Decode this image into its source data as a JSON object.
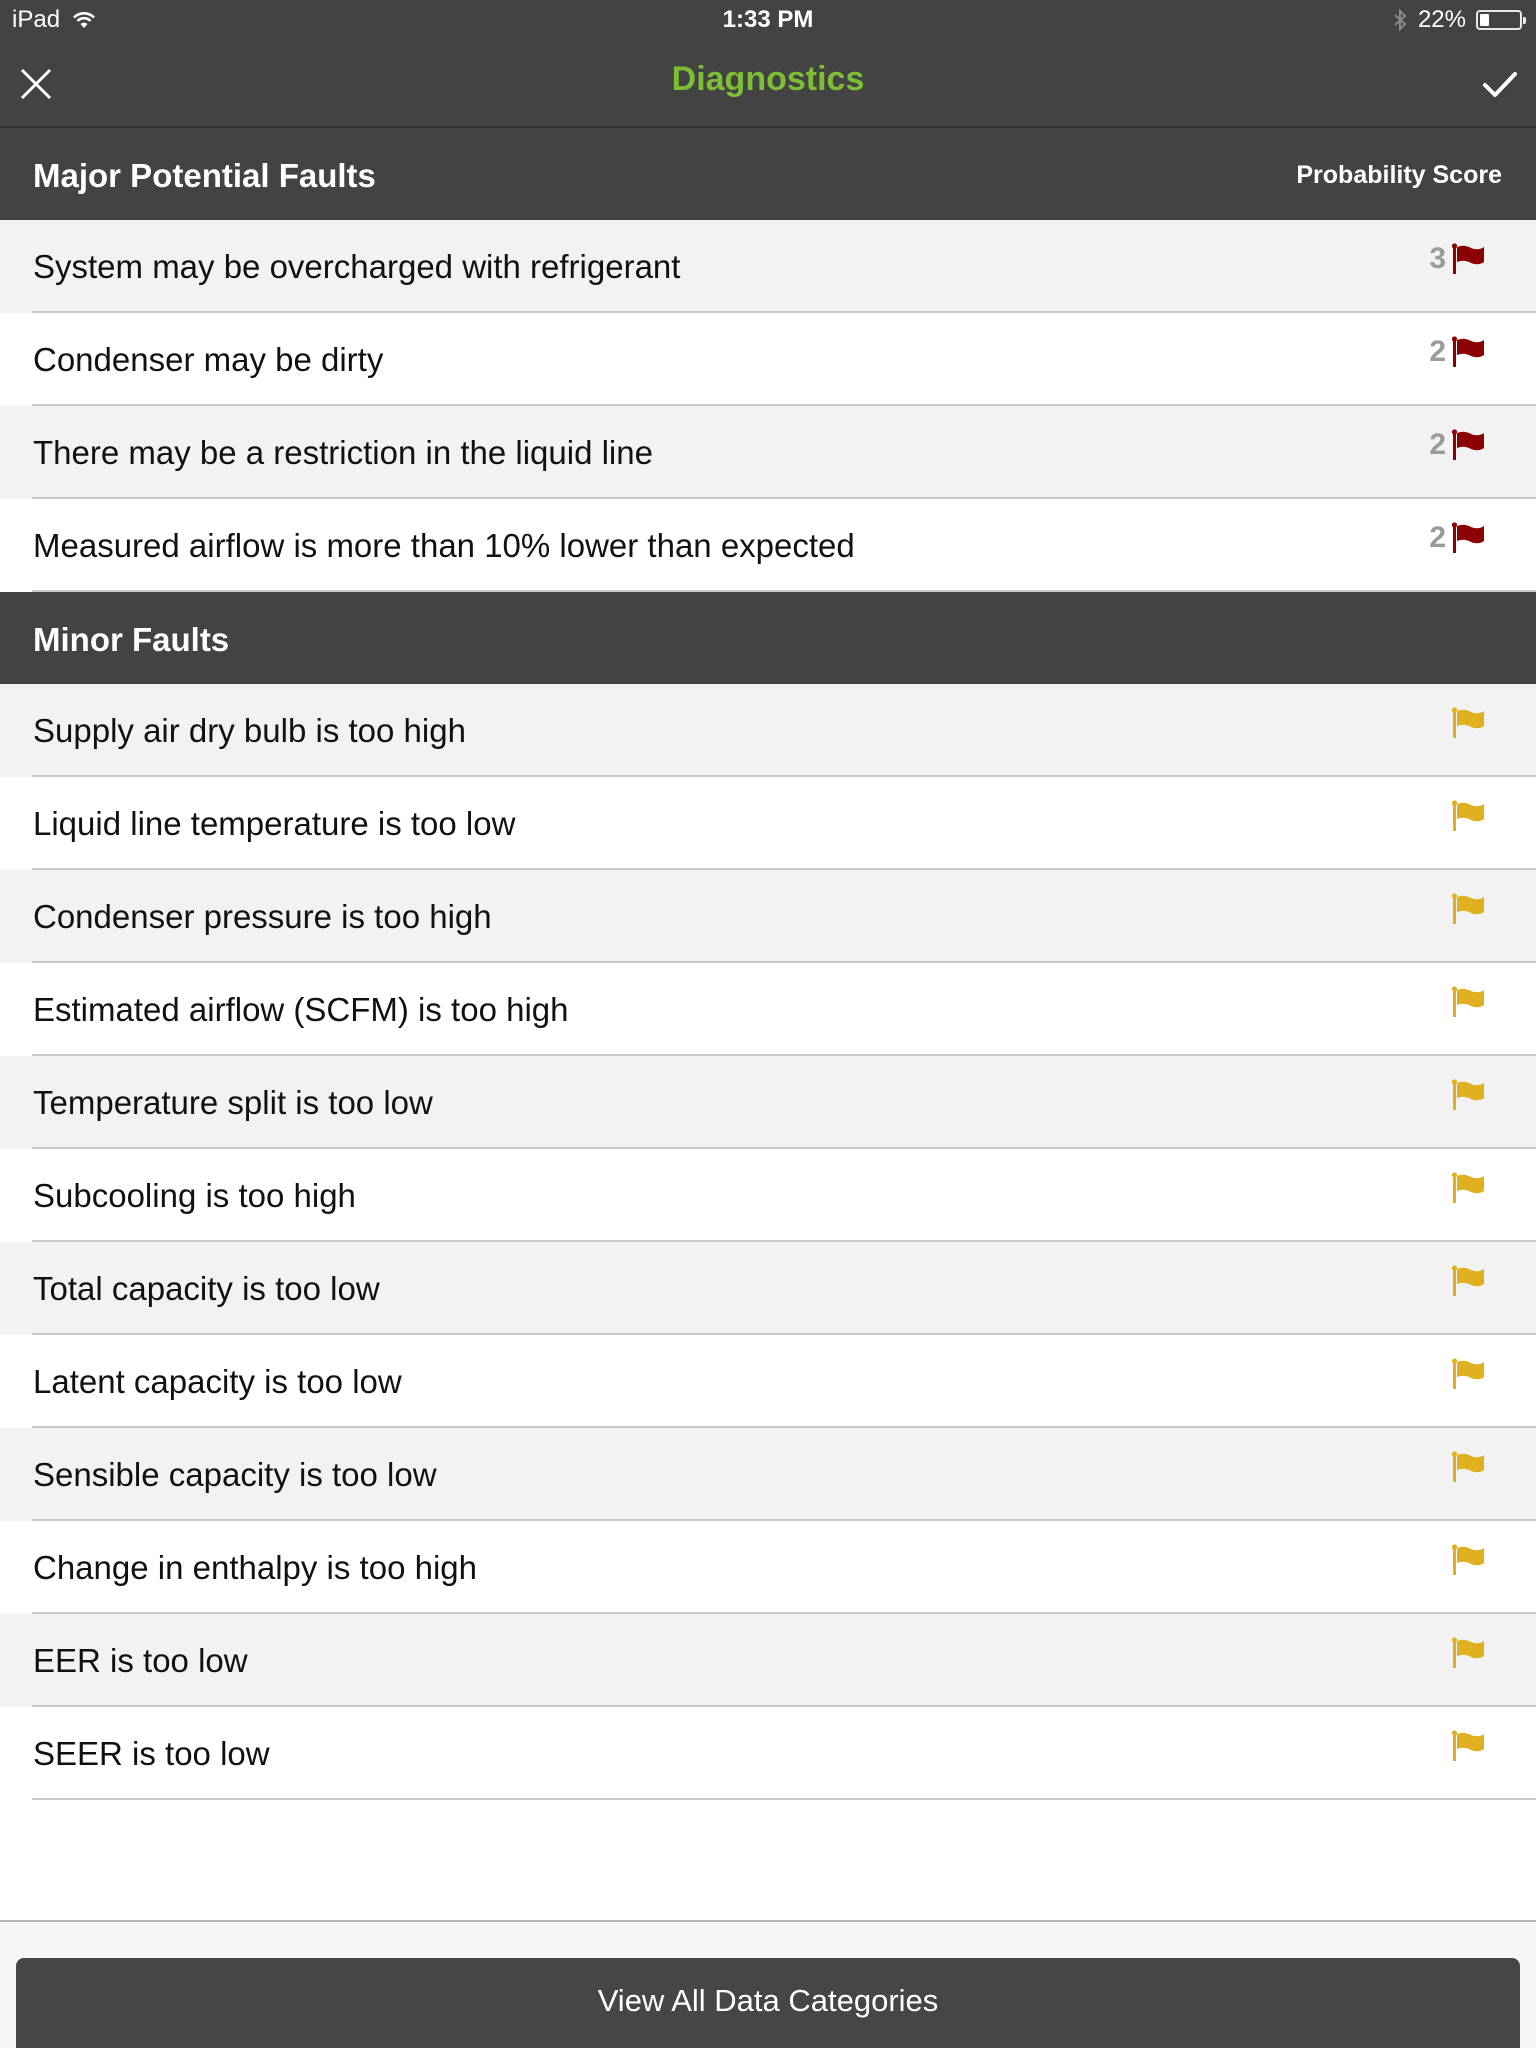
{
  "status_bar": {
    "carrier": "iPad",
    "time": "1:33 PM",
    "battery_percent_label": "22%",
    "battery_level": 0.22,
    "icons": [
      "wifi-icon",
      "bluetooth-icon",
      "battery-icon"
    ]
  },
  "nav": {
    "title": "Diagnostics",
    "close_icon": "close-icon",
    "done_icon": "checkmark-icon"
  },
  "colors": {
    "title_green": "#7dbe35",
    "header_bg": "#434343",
    "major_flag": "#8b0000",
    "minor_flag": "#e0b020",
    "score_gray": "#9a9a9a"
  },
  "major": {
    "title": "Major Potential Faults",
    "score_header": "Probability Score",
    "items": [
      {
        "label": "System may be overcharged with refrigerant",
        "score": "3"
      },
      {
        "label": "Condenser may be dirty",
        "score": "2"
      },
      {
        "label": "There may be a restriction in the liquid line",
        "score": "2"
      },
      {
        "label": "Measured airflow is more than 10% lower than expected",
        "score": "2"
      }
    ]
  },
  "minor": {
    "title": "Minor Faults",
    "items": [
      {
        "label": "Supply air dry bulb is too high"
      },
      {
        "label": "Liquid line temperature is too low"
      },
      {
        "label": "Condenser pressure is too high"
      },
      {
        "label": "Estimated airflow (SCFM) is too high"
      },
      {
        "label": "Temperature split is too low"
      },
      {
        "label": "Subcooling is too high"
      },
      {
        "label": "Total capacity is too low"
      },
      {
        "label": "Latent capacity is too low"
      },
      {
        "label": "Sensible capacity is too low"
      },
      {
        "label": "Change in enthalpy is too high"
      },
      {
        "label": "EER is too low"
      },
      {
        "label": "SEER is too low"
      }
    ]
  },
  "footer": {
    "button_label": "View All Data Categories"
  }
}
